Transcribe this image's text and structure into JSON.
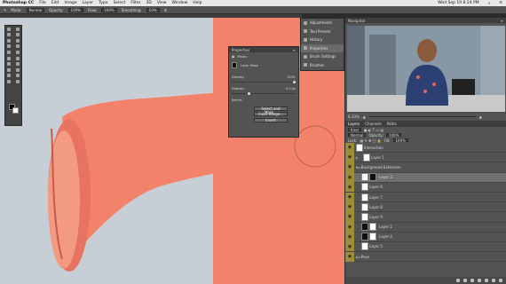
{
  "menubar": {
    "app": "Photoshop CC",
    "items": [
      "File",
      "Edit",
      "Image",
      "Layer",
      "Type",
      "Select",
      "Filter",
      "3D",
      "View",
      "Window",
      "Help"
    ],
    "clock": "Wed Sep 19 8:24 PM"
  },
  "options": {
    "mode_label": "Mode:",
    "mode_value": "Normal",
    "opacity_label": "Opacity:",
    "opacity_value": "100%",
    "flow_label": "Flow:",
    "flow_value": "100%",
    "smoothing_label": "Smoothing:",
    "smoothing_value": "10%"
  },
  "properties": {
    "title": "Properties",
    "section": "Masks",
    "sub": "Layer Mask",
    "density_label": "Density:",
    "density_value": "100%",
    "feather_label": "Feather:",
    "feather_value": "0.0 px",
    "refine_label": "Refine:",
    "btn1": "Select and Mask...",
    "btn2": "Color Range...",
    "btn3": "Invert"
  },
  "dock": {
    "items": [
      "Adjustments",
      "Tool Presets",
      "History",
      "Properties",
      "Brush Settings",
      "Brushes"
    ]
  },
  "navigator": {
    "title": "Navigator",
    "zoom": "8.33%"
  },
  "layers": {
    "tabs": [
      "Layers",
      "Channels",
      "Paths"
    ],
    "kind": "Kind",
    "mode": "Normal",
    "opacity_label": "Opacity:",
    "opacity_value": "100%",
    "lock_label": "Lock:",
    "fill_label": "Fill:",
    "fill_value": "100%",
    "rows": [
      {
        "name": "Interaction"
      },
      {
        "name": "Layer 1"
      },
      {
        "name": "Background Extension"
      },
      {
        "name": "Layer 3"
      },
      {
        "name": "Layer 6"
      },
      {
        "name": "Layer 7"
      },
      {
        "name": "Layer 8"
      },
      {
        "name": "Layer 9"
      },
      {
        "name": "Layer 2"
      },
      {
        "name": "Layer 4"
      },
      {
        "name": "Layer 5"
      },
      {
        "name": "Pose"
      }
    ]
  },
  "colors": {
    "salmon": "#f2826a",
    "wall": "#c8ced6",
    "panel": "#535353"
  }
}
